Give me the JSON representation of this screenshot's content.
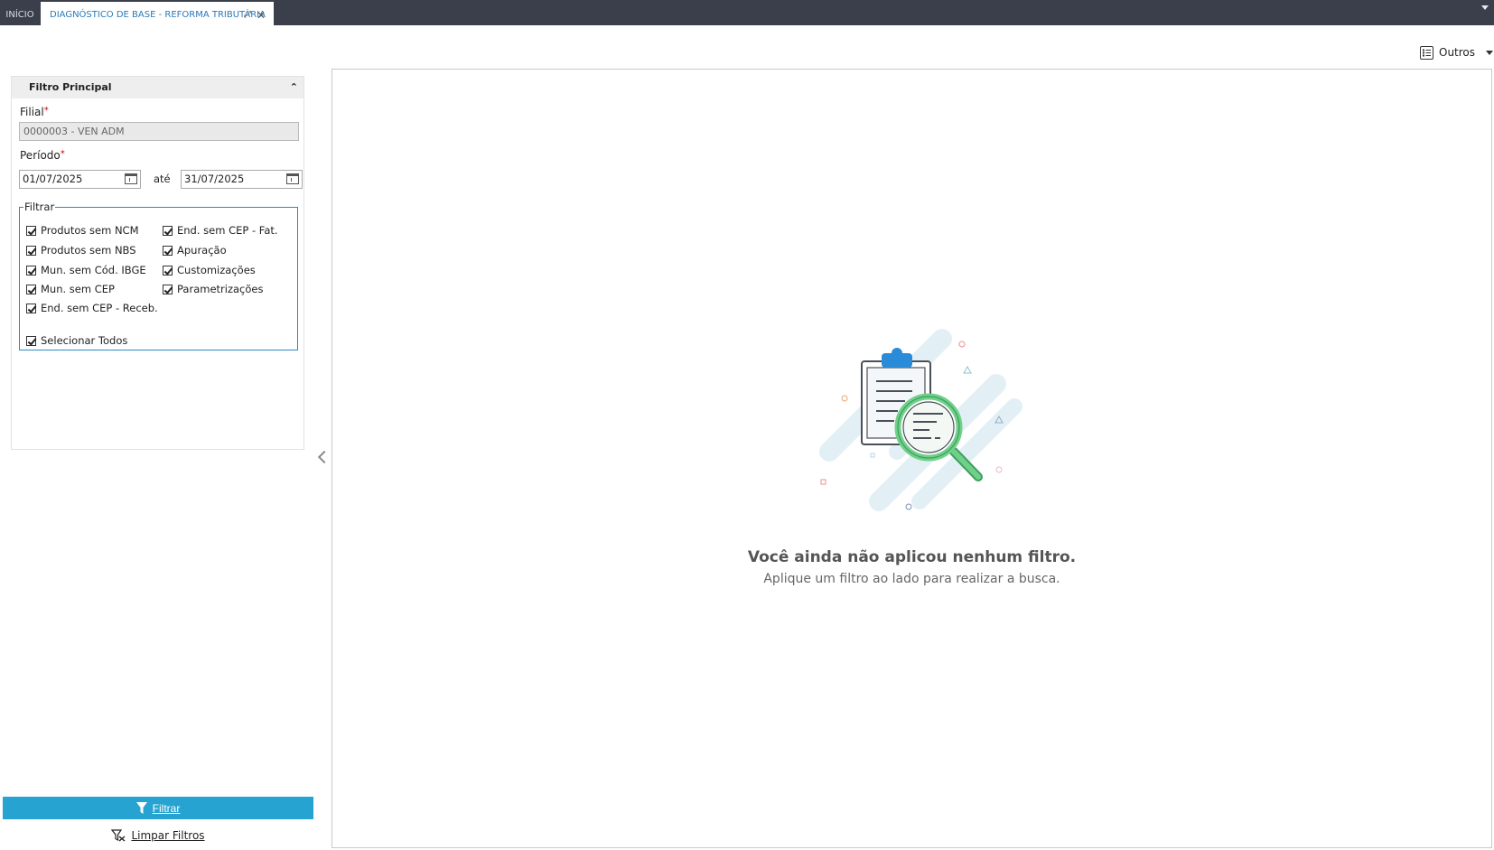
{
  "tabs": {
    "home": "INÍCIO",
    "active": "DIAGNÓSTICO DE BASE - REFORMA TRIBUTÁRIA"
  },
  "toolbar": {
    "outros_label": "Outros"
  },
  "filter_panel": {
    "title": "Filtro Principal",
    "filial_label": "Filial",
    "filial_value": "0000003 - VEN ADM",
    "periodo_label": "Período",
    "date_from": "01/07/2025",
    "ate_label": "até",
    "date_to": "31/07/2025",
    "group_label": "Filtrar",
    "checkboxes": [
      {
        "label": "Produtos sem NCM",
        "checked": true
      },
      {
        "label": "Produtos sem NBS",
        "checked": true
      },
      {
        "label": "Mun. sem Cód. IBGE",
        "checked": true
      },
      {
        "label": "Mun. sem CEP",
        "checked": true
      },
      {
        "label": "End. sem CEP - Receb.",
        "checked": true
      },
      {
        "label": "End. sem CEP - Fat.",
        "checked": true
      },
      {
        "label": "Apuração",
        "checked": true
      },
      {
        "label": "Customizações",
        "checked": true
      },
      {
        "label": "Parametrizações",
        "checked": true
      }
    ],
    "select_all": {
      "label": "Selecionar Todos",
      "checked": true
    }
  },
  "actions": {
    "filtrar": "Filtrar",
    "limpar": "Limpar Filtros"
  },
  "empty_state": {
    "title": "Você ainda não aplicou nenhum filtro.",
    "subtitle": "Aplique um filtro ao lado para realizar a busca."
  },
  "colors": {
    "tabbar": "#3a3f4b",
    "accent": "#27a3d1",
    "fieldset_border": "#2c8ac4",
    "required": "#d0021b"
  }
}
